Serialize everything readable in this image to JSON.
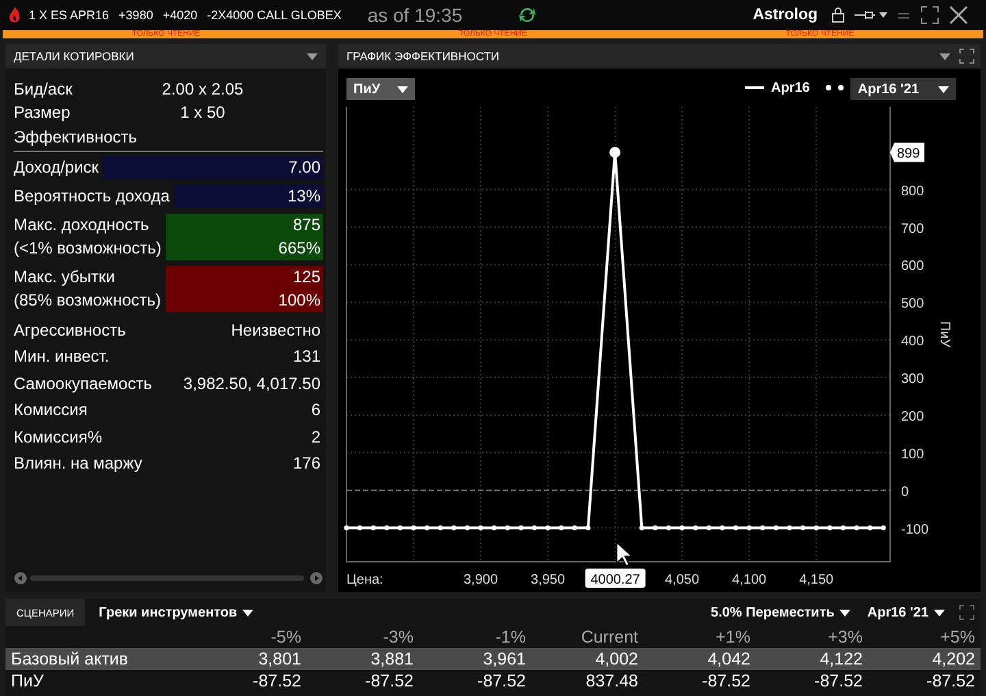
{
  "top_bar": {
    "instrument": [
      "1 X ES APR16",
      "+3980",
      "+4020",
      "-2X4000 CALL GLOBEX"
    ],
    "as_of": "as of 19:35",
    "account": "Astrolog"
  },
  "read_only_banner": [
    "ТОЛЬКО ЧТЕНИЕ",
    "ТОЛЬКО ЧТЕНИЕ",
    "ТОЛЬКО ЧТЕНИЕ"
  ],
  "quote_details": {
    "title": "ДЕТАЛИ КОТИРОВКИ",
    "quote": [
      {
        "label": "Бид/аск",
        "value": "2.00 x 2.05"
      },
      {
        "label": "Размер",
        "value": "1 x 50"
      }
    ],
    "section": "Эффективность",
    "metrics": [
      {
        "lines": [
          {
            "label": "Доход/риск",
            "value": "7.00"
          }
        ],
        "color": "#0d0d38"
      },
      {
        "lines": [
          {
            "label": "Вероятность дохода",
            "value": "13%"
          }
        ],
        "color": "#0d0d38"
      },
      {
        "lines": [
          {
            "label": "Макс. доходность",
            "value": "875"
          },
          {
            "label": "(<1% возможность)",
            "value": "665%"
          }
        ],
        "color": "#0b4a0b"
      },
      {
        "lines": [
          {
            "label": "Макс. убытки",
            "value": "125"
          },
          {
            "label": "(85% возможность)",
            "value": "100%"
          }
        ],
        "color": "#6b0000"
      }
    ],
    "stats": [
      {
        "label": "Агрессивность",
        "value": "Неизвестно"
      },
      {
        "label": "Мин. инвест.",
        "value": "131"
      },
      {
        "label": "Самоокупаемость",
        "value": "3,982.50, 4,017.50"
      },
      {
        "label": "Комиссия",
        "value": "6"
      },
      {
        "label": "Комиссия%",
        "value": "2"
      },
      {
        "label": "Влиян. на маржу",
        "value": "176"
      }
    ]
  },
  "performance_chart": {
    "title": "ГРАФИК ЭФФЕКТИВНОСТИ",
    "metric_dropdown": "ПиУ",
    "date_dropdown": "Apr16 '21",
    "chart_data": {
      "type": "line",
      "xlabel": "Цена:",
      "ylabel": "ПиУ",
      "x": [
        3800,
        3810,
        3820,
        3830,
        3840,
        3850,
        3860,
        3870,
        3880,
        3890,
        3900,
        3910,
        3920,
        3930,
        3940,
        3950,
        3960,
        3970,
        3980,
        4000,
        4020,
        4030,
        4040,
        4050,
        4060,
        4070,
        4080,
        4090,
        4100,
        4110,
        4120,
        4130,
        4140,
        4150,
        4160,
        4170,
        4180,
        4190,
        4200
      ],
      "series": [
        {
          "name": "Apr16",
          "color": "#ffffff",
          "marker": "o",
          "values": [
            -100,
            -100,
            -100,
            -100,
            -100,
            -100,
            -100,
            -100,
            -100,
            -100,
            -100,
            -100,
            -100,
            -100,
            -100,
            -100,
            -100,
            -100,
            -100,
            899,
            -100,
            -100,
            -100,
            -100,
            -100,
            -100,
            -100,
            -100,
            -100,
            -100,
            -100,
            -100,
            -100,
            -100,
            -100,
            -100,
            -100,
            -100,
            -100
          ]
        }
      ],
      "xlim": [
        3800,
        4205
      ],
      "ylim": [
        -190,
        1020
      ],
      "xticks": [
        {
          "value": 3900,
          "label": "3,900"
        },
        {
          "value": 3950,
          "label": "3,950"
        },
        {
          "value": 4050,
          "label": "4,050"
        },
        {
          "value": 4100,
          "label": "4,100"
        },
        {
          "value": 4150,
          "label": "4,150"
        }
      ],
      "grid": true,
      "ref_lines": [
        {
          "axis": "y",
          "value": 0
        }
      ],
      "yticks": [
        -100,
        0,
        100,
        200,
        300,
        400,
        500,
        600,
        700,
        800
      ],
      "annotations": [
        {
          "y": 899,
          "text": "899"
        },
        {
          "x": 4000.27,
          "text": "4000.27"
        }
      ]
    }
  },
  "scenarios": {
    "tab": "СЦЕНАРИИ",
    "greeks_dropdown": "Греки инструментов",
    "move_dropdown": "5.0% Переместить",
    "date_dropdown": "Apr16 '21",
    "columns": [
      "-5%",
      "-3%",
      "-1%",
      "Current",
      "+1%",
      "+3%",
      "+5%"
    ],
    "rows": [
      {
        "label": "Базовый актив",
        "cells": [
          "3,801",
          "3,881",
          "3,961",
          "4,002",
          "4,042",
          "4,122",
          "4,202"
        ],
        "selected": true
      },
      {
        "label": "ПиУ",
        "cells": [
          "-87.52",
          "-87.52",
          "-87.52",
          "837.48",
          "-87.52",
          "-87.52",
          "-87.52"
        ],
        "selected": false
      }
    ]
  }
}
